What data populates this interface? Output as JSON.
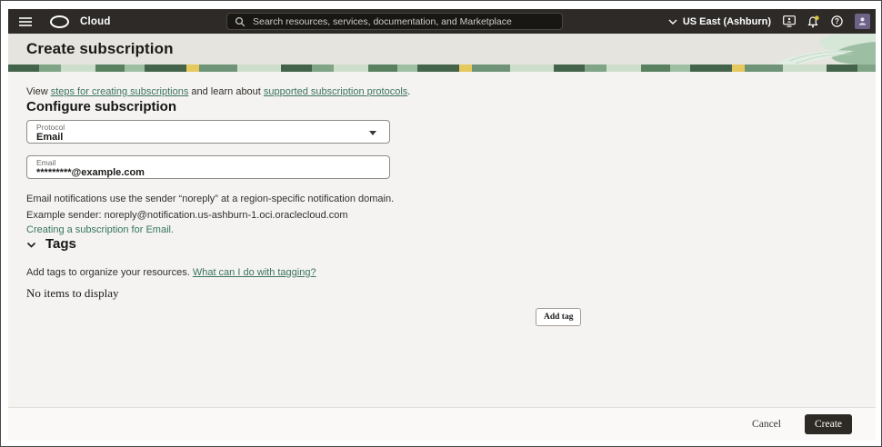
{
  "header": {
    "brand": "Cloud",
    "search_placeholder": "Search resources, services, documentation, and Marketplace",
    "region_label": "US East (Ashburn)",
    "help_glyph": "?"
  },
  "page": {
    "title": "Create subscription",
    "intro_prefix": "View ",
    "intro_link_steps": "steps for creating subscriptions",
    "intro_middle": " and learn about ",
    "intro_link_protocols": "supported subscription protocols",
    "intro_suffix": "."
  },
  "form": {
    "heading": "Configure subscription",
    "protocol_label": "Protocol",
    "protocol_value": "Email",
    "email_label": "Email",
    "email_value": "*********@example.com",
    "note_sender": "Email notifications use the sender “noreply” at a region-specific notification domain.",
    "note_example": "Example sender: noreply@notification.us-ashburn-1.oci.oraclecloud.com",
    "doc_link": "Creating a subscription for Email."
  },
  "tags": {
    "heading": "Tags",
    "description_prefix": "Add tags to organize your resources. ",
    "description_link": "What can I do with tagging?",
    "empty_message": "No items to display",
    "add_button_label": "Add tag"
  },
  "footer": {
    "cancel_label": "Cancel",
    "create_label": "Create"
  },
  "icons": {
    "menu-icon": "three horizontal bars",
    "oracle-logo": "white oval ring",
    "search-icon": "magnifier",
    "chevron-down-icon": "∨",
    "monitor-icon": "display with person",
    "bell-icon": "bell with status dot",
    "help-icon": "circled question mark",
    "user-icon": "person silhouette",
    "dropdown-caret-icon": "▾",
    "section-chevron-icon": "⌄"
  },
  "colors": {
    "topbar_bg": "#2d2a27",
    "search_bg": "#191714",
    "titlebar_bg": "#e6e4df",
    "content_bg": "#f4f3f1",
    "footer_bg": "#faf9f7",
    "link": "#3c7460",
    "create_button_bg": "#2d2a26",
    "avatar_bg": "#6d6287",
    "notification_dot": "#d8c33c",
    "strip_greens": [
      "#44634b",
      "#7fa486",
      "#cddfcc",
      "#59815f",
      "#e5c95f"
    ]
  }
}
